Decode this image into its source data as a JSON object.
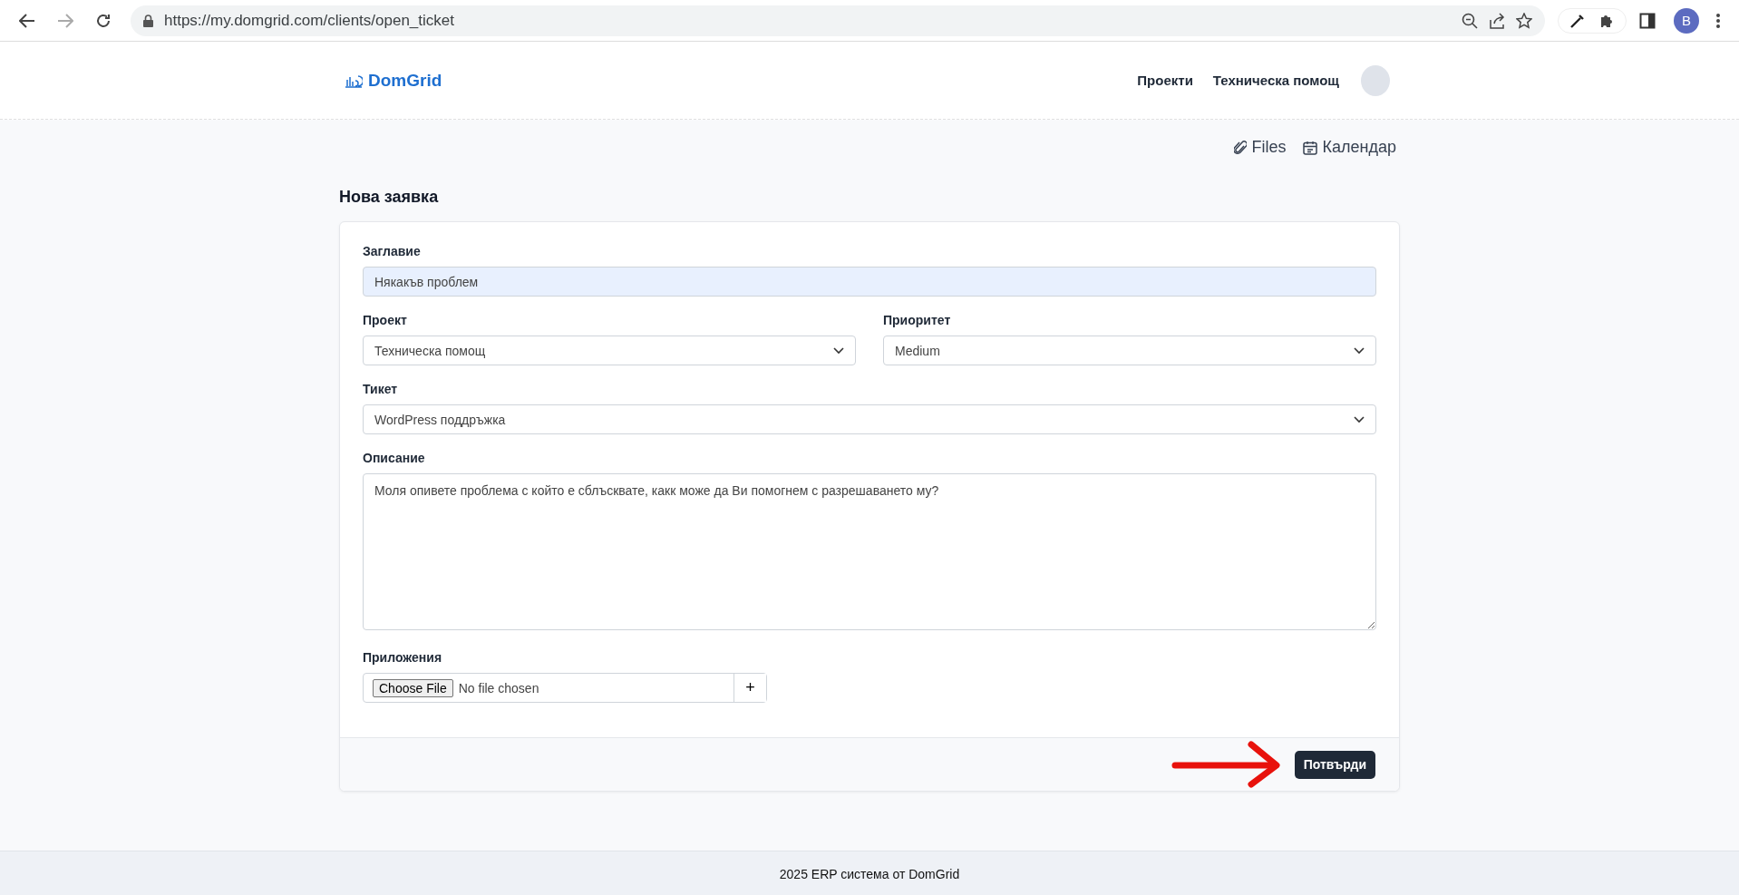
{
  "browser": {
    "url": "https://my.domgrid.com/clients/open_ticket",
    "profile_letter": "B"
  },
  "header": {
    "brand": "DomGrid",
    "nav": [
      "Проекти",
      "Техническа помощ"
    ]
  },
  "toolbar": [
    "Files",
    "Календар"
  ],
  "page_title": "Нова заявка",
  "form": {
    "title": {
      "label": "Заглавие",
      "value": "Някакъв проблем"
    },
    "project": {
      "label": "Проект",
      "value": "Техническа помощ"
    },
    "priority": {
      "label": "Приоритет",
      "value": "Medium"
    },
    "ticket": {
      "label": "Тикет",
      "value": "WordPress поддръжка"
    },
    "description": {
      "label": "Описание",
      "placeholder": "Моля опивете проблема с който е сблъсквате, какк може да Ви помогнем с разрешаването му?"
    },
    "attachments": {
      "label": "Приложения",
      "button": "Choose File",
      "status": "No file chosen",
      "add": "+"
    },
    "submit": "Потвърди"
  },
  "footer": "2025 ERP система от DomGrid"
}
